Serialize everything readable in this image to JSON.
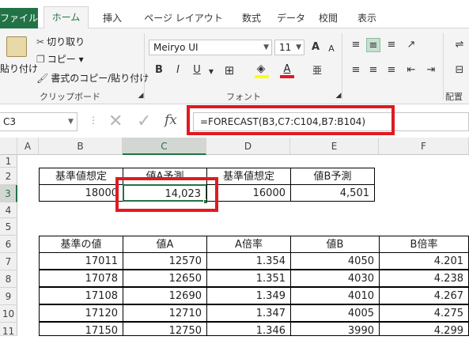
{
  "tabs": [
    "ファイル",
    "ホーム",
    "挿入",
    "ページ レイアウト",
    "数式",
    "データ",
    "校閲",
    "表示"
  ],
  "clipboard": {
    "paste": "貼り付け",
    "cut": "切り取り",
    "copy": "コピー ▾",
    "format_painter": "書式のコピー/貼り付け",
    "group": "クリップボード"
  },
  "font": {
    "name": "Meiryo UI",
    "size": "11",
    "group": "フォント",
    "bold": "B",
    "italic": "I",
    "underline": "U",
    "grow": "A",
    "shrink": "A"
  },
  "alignment": {
    "group": "配置"
  },
  "namebox": "C3",
  "fx": "fx",
  "formula": "=FORECAST(B3,C7:C104,B7:B104)",
  "columns": [
    "A",
    "B",
    "C",
    "D",
    "E",
    "F"
  ],
  "rows": [
    "1",
    "2",
    "3",
    "4",
    "5",
    "6",
    "7",
    "8",
    "9",
    "10",
    "11"
  ],
  "top_table": {
    "headers": [
      "基準値想定",
      "値A予測",
      "基準値想定",
      "値B予測"
    ],
    "values": [
      "18000",
      "14,023",
      "16000",
      "4,501"
    ]
  },
  "data_table": {
    "headers": [
      "基準の値",
      "値A",
      "A倍率",
      "値B",
      "B倍率"
    ],
    "rows": [
      [
        "17011",
        "12570",
        "1.354",
        "4050",
        "4.201"
      ],
      [
        "17078",
        "12650",
        "1.351",
        "4030",
        "4.238"
      ],
      [
        "17108",
        "12690",
        "1.349",
        "4010",
        "4.267"
      ],
      [
        "17120",
        "12710",
        "1.347",
        "4005",
        "4.275"
      ],
      [
        "17150",
        "12750",
        "1.346",
        "3990",
        "4.299"
      ]
    ]
  },
  "colors": {
    "excel_green": "#217346",
    "highlight_red": "#e01a22",
    "selected_header": "#dfe3e0"
  }
}
